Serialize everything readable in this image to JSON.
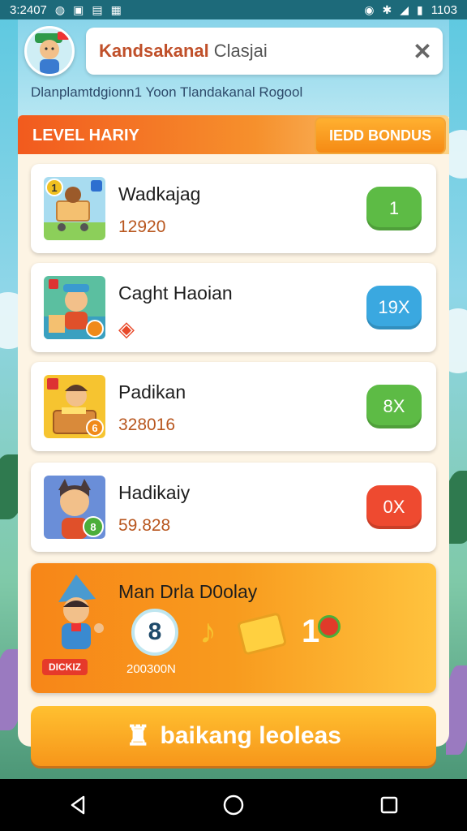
{
  "status_bar": {
    "time": "3:2407",
    "right_text": "1103",
    "icons": [
      "app-icon",
      "gallery-icon",
      "calendar-icon",
      "alarm-icon",
      "bluetooth-icon",
      "signal-icon",
      "battery-icon"
    ]
  },
  "header": {
    "search_title": "Kandsakanal",
    "search_sub": "Clasjai",
    "subtitle": "Dlanplamtdgionn1 Yoon Tlandakanal Rogool"
  },
  "level": {
    "title": "LEVEL HARIY",
    "bonus_label": "IEDD BONDUS"
  },
  "items": [
    {
      "title": "Wadkajag",
      "value": "12920",
      "pill": "1",
      "pill_color": "#5dbb45"
    },
    {
      "title": "Caght Haoian",
      "value": "",
      "pill": "19X",
      "pill_color": "#3aa8e0"
    },
    {
      "title": "Padikan",
      "value": "328016",
      "pill": "8X",
      "pill_color": "#5dbb45"
    },
    {
      "title": "Hadikaiy",
      "value": "59.828",
      "pill": "0X",
      "pill_color": "#ee4a30"
    }
  ],
  "item_badges": [
    "1",
    "",
    "6",
    "8"
  ],
  "reward": {
    "title": "Man Drla D0olay",
    "count": "8",
    "amount": "200300N",
    "tag": "DICKIZ",
    "extra": "1"
  },
  "action": {
    "label": "baikang leoleas"
  },
  "colors": {
    "accent": "#f7961a",
    "header_gradient_start": "#f25a1e"
  }
}
